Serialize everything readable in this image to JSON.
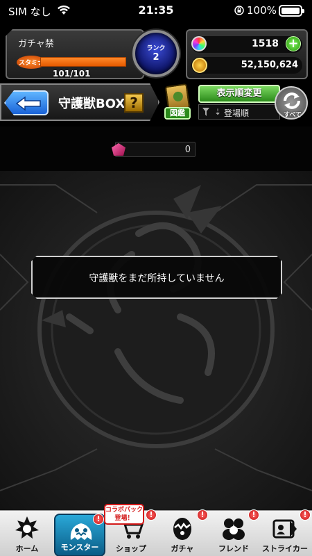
{
  "status_bar": {
    "carrier": "SIM なし",
    "time": "21:35",
    "battery": "100%"
  },
  "header": {
    "player_name": "ガチャ禁",
    "stamina_label": "スタミナ",
    "stamina_text": "101/101",
    "stamina_fraction": 1.0,
    "rank_label": "ランク",
    "rank_value": "2",
    "orbs": "1518",
    "coins": "52,150,624"
  },
  "title_bar": {
    "title": "守護獣BOX",
    "help_label": "?",
    "zukan_label": "図鑑",
    "sort_button_label": "表示順変更",
    "sort_selected": "登場順",
    "all_label": "すべて"
  },
  "count": {
    "value": "0"
  },
  "main": {
    "empty_message": "守護獣をまだ所持していません"
  },
  "bottom_nav": {
    "items": [
      {
        "label": "ホーム"
      },
      {
        "label": "モンスター",
        "badge": "!"
      },
      {
        "label": "ショップ",
        "badge": "!"
      },
      {
        "label": "ガチャ",
        "badge": "!"
      },
      {
        "label": "フレンド",
        "badge": "!"
      },
      {
        "label": "ストライカー",
        "badge": "!"
      }
    ],
    "collab_badge": "コラボパック登場！"
  },
  "colors": {
    "accent_green": "#2b8a1a",
    "accent_blue": "#1a63d8",
    "stamina_orange": "#e65a00",
    "badge_red": "#c41212"
  }
}
